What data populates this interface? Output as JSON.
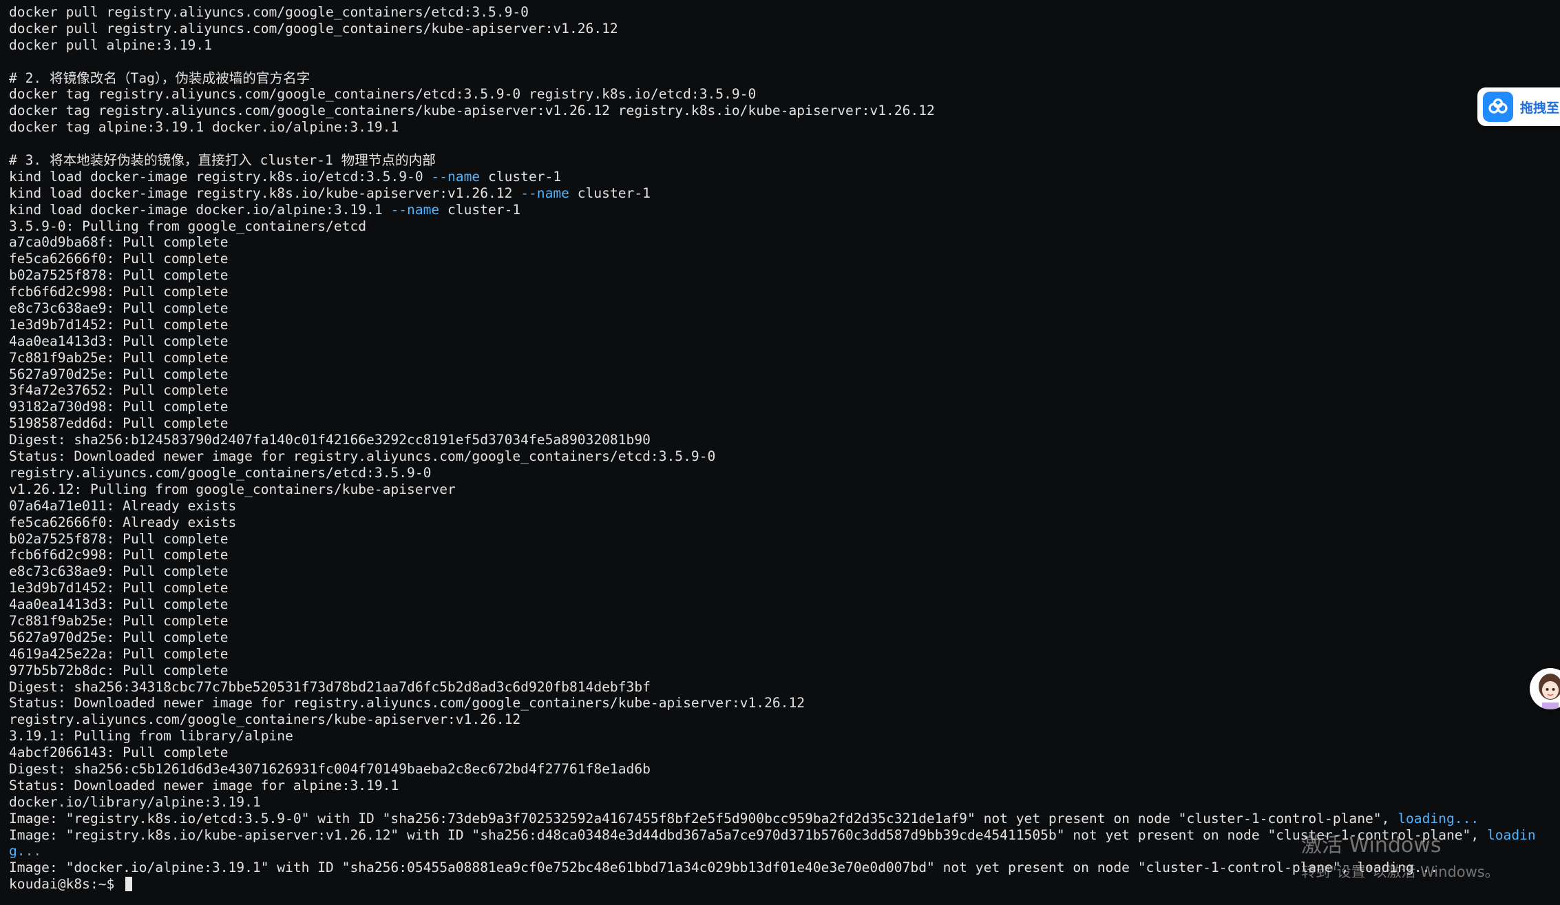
{
  "terminal": {
    "lines": [
      [
        {
          "t": "docker pull registry.aliyuncs.com/google_containers/etcd:3.5.9-0"
        }
      ],
      [
        {
          "t": "docker pull registry.aliyuncs.com/google_containers/kube-apiserver:v1.26.12"
        }
      ],
      [
        {
          "t": "docker pull alpine:3.19.1"
        }
      ],
      [
        {
          "t": ""
        }
      ],
      [
        {
          "t": "# 2. 将镜像改名（Tag），伪装成被墙的官方名字"
        }
      ],
      [
        {
          "t": "docker tag registry.aliyuncs.com/google_containers/etcd:3.5.9-0 registry.k8s.io/etcd:3.5.9-0"
        }
      ],
      [
        {
          "t": "docker tag registry.aliyuncs.com/google_containers/kube-apiserver:v1.26.12 registry.k8s.io/kube-apiserver:v1.26.12"
        }
      ],
      [
        {
          "t": "docker tag alpine:3.19.1 docker.io/alpine:3.19.1"
        }
      ],
      [
        {
          "t": ""
        }
      ],
      [
        {
          "t": "# 3. 将本地装好伪装的镜像，直接打入 cluster-1 物理节点的内部"
        }
      ],
      [
        {
          "t": "kind load docker-image registry.k8s.io/etcd:3.5.9-0 "
        },
        {
          "t": "--name",
          "c": "opt"
        },
        {
          "t": " cluster-1"
        }
      ],
      [
        {
          "t": "kind load docker-image registry.k8s.io/kube-apiserver:v1.26.12 "
        },
        {
          "t": "--name",
          "c": "opt"
        },
        {
          "t": " cluster-1"
        }
      ],
      [
        {
          "t": "kind load docker-image docker.io/alpine:3.19.1 "
        },
        {
          "t": "--name",
          "c": "opt"
        },
        {
          "t": " cluster-1"
        }
      ],
      [
        {
          "t": "3.5.9-0: Pulling from google_containers/etcd"
        }
      ],
      [
        {
          "t": "a7ca0d9ba68f: Pull complete"
        }
      ],
      [
        {
          "t": "fe5ca62666f0: Pull complete"
        }
      ],
      [
        {
          "t": "b02a7525f878: Pull complete"
        }
      ],
      [
        {
          "t": "fcb6f6d2c998: Pull complete"
        }
      ],
      [
        {
          "t": "e8c73c638ae9: Pull complete"
        }
      ],
      [
        {
          "t": "1e3d9b7d1452: Pull complete"
        }
      ],
      [
        {
          "t": "4aa0ea1413d3: Pull complete"
        }
      ],
      [
        {
          "t": "7c881f9ab25e: Pull complete"
        }
      ],
      [
        {
          "t": "5627a970d25e: Pull complete"
        }
      ],
      [
        {
          "t": "3f4a72e37652: Pull complete"
        }
      ],
      [
        {
          "t": "93182a730d98: Pull complete"
        }
      ],
      [
        {
          "t": "5198587edd6d: Pull complete"
        }
      ],
      [
        {
          "t": "Digest: sha256:b124583790d2407fa140c01f42166e3292cc8191ef5d37034fe5a89032081b90"
        }
      ],
      [
        {
          "t": "Status: Downloaded newer image for registry.aliyuncs.com/google_containers/etcd:3.5.9-0"
        }
      ],
      [
        {
          "t": "registry.aliyuncs.com/google_containers/etcd:3.5.9-0"
        }
      ],
      [
        {
          "t": "v1.26.12: Pulling from google_containers/kube-apiserver"
        }
      ],
      [
        {
          "t": "07a64a71e011: Already exists"
        }
      ],
      [
        {
          "t": "fe5ca62666f0: Already exists"
        }
      ],
      [
        {
          "t": "b02a7525f878: Pull complete"
        }
      ],
      [
        {
          "t": "fcb6f6d2c998: Pull complete"
        }
      ],
      [
        {
          "t": "e8c73c638ae9: Pull complete"
        }
      ],
      [
        {
          "t": "1e3d9b7d1452: Pull complete"
        }
      ],
      [
        {
          "t": "4aa0ea1413d3: Pull complete"
        }
      ],
      [
        {
          "t": "7c881f9ab25e: Pull complete"
        }
      ],
      [
        {
          "t": "5627a970d25e: Pull complete"
        }
      ],
      [
        {
          "t": "4619a425e22a: Pull complete"
        }
      ],
      [
        {
          "t": "977b5b72b8dc: Pull complete"
        }
      ],
      [
        {
          "t": "Digest: sha256:34318cbc77c7bbe520531f73d78bd21aa7d6fc5b2d8ad3c6d920fb814debf3bf"
        }
      ],
      [
        {
          "t": "Status: Downloaded newer image for registry.aliyuncs.com/google_containers/kube-apiserver:v1.26.12"
        }
      ],
      [
        {
          "t": "registry.aliyuncs.com/google_containers/kube-apiserver:v1.26.12"
        }
      ],
      [
        {
          "t": "3.19.1: Pulling from library/alpine"
        }
      ],
      [
        {
          "t": "4abcf2066143: Pull complete"
        }
      ],
      [
        {
          "t": "Digest: sha256:c5b1261d6d3e43071626931fc004f70149baeba2c8ec672bd4f27761f8e1ad6b"
        }
      ],
      [
        {
          "t": "Status: Downloaded newer image for alpine:3.19.1"
        }
      ],
      [
        {
          "t": "docker.io/library/alpine:3.19.1"
        }
      ],
      [
        {
          "t": "Image: \"registry.k8s.io/etcd:3.5.9-0\" with ID \"sha256:73deb9a3f702532592a4167455f8bf2e5f5d900bcc959ba2fd2d35c321de1af9\" not yet present on node \"cluster-1-control-plane\", "
        },
        {
          "t": "loading...",
          "c": "loading"
        }
      ],
      [
        {
          "t": "Image: \"registry.k8s.io/kube-apiserver:v1.26.12\" with ID \"sha256:d48ca03484e3d44dbd367a5a7ce970d371b5760c3dd587d9bb39cde45411505b\" not yet present on node \"cluster-1-control-plane\", "
        },
        {
          "t": "loadin",
          "c": "loading"
        }
      ],
      [
        {
          "t": "g...",
          "c": "loading"
        }
      ],
      [
        {
          "t": "Image: \"docker.io/alpine:3.19.1\" with ID \"sha256:05455a08881ea9cf0e752bc48e61bbd71a34c029bb13df01e40e3e70e0d007bd\" not yet present on node \"cluster-1-control-plane\", loading..."
        }
      ]
    ],
    "prompt": "koudai@k8s:~$ "
  },
  "widget": {
    "label": "拖拽至",
    "icon": "cloud-drive-icon"
  },
  "avatar": {
    "icon": "assistant-avatar-icon"
  },
  "watermark": {
    "title": "激活 Windows",
    "subtitle": "转到\"设置\"以激活 Windows。"
  },
  "colors": {
    "background": "#0c0d0f",
    "text": "#e2e2e2",
    "option": "#4fb3ff",
    "widget_accent": "#1f8bff"
  }
}
